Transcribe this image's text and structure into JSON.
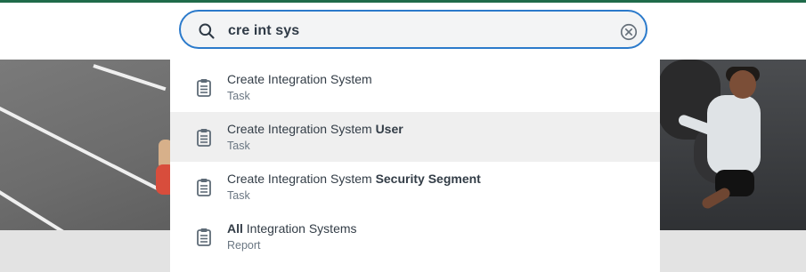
{
  "search": {
    "query": "cre int sys"
  },
  "results": [
    {
      "title_parts": [
        {
          "text": "Create",
          "weight": "normal"
        },
        {
          "text": " ",
          "weight": "normal"
        },
        {
          "text": "Integration",
          "weight": "normal"
        },
        {
          "text": " ",
          "weight": "normal"
        },
        {
          "text": "System",
          "weight": "normal"
        }
      ],
      "type": "Task",
      "highlighted": false
    },
    {
      "title_parts": [
        {
          "text": "Create",
          "weight": "normal"
        },
        {
          "text": " ",
          "weight": "normal"
        },
        {
          "text": "Integration",
          "weight": "normal"
        },
        {
          "text": " ",
          "weight": "normal"
        },
        {
          "text": "System",
          "weight": "normal"
        },
        {
          "text": " ",
          "weight": "normal"
        },
        {
          "text": "User",
          "weight": "bold"
        }
      ],
      "type": "Task",
      "highlighted": true
    },
    {
      "title_parts": [
        {
          "text": "Create",
          "weight": "normal"
        },
        {
          "text": " ",
          "weight": "normal"
        },
        {
          "text": "Integration",
          "weight": "normal"
        },
        {
          "text": " ",
          "weight": "normal"
        },
        {
          "text": "System",
          "weight": "normal"
        },
        {
          "text": " ",
          "weight": "normal"
        },
        {
          "text": "Security Segment",
          "weight": "bold"
        }
      ],
      "type": "Task",
      "highlighted": false
    },
    {
      "title_parts": [
        {
          "text": "All",
          "weight": "bold"
        },
        {
          "text": " ",
          "weight": "normal"
        },
        {
          "text": "Integration",
          "weight": "normal"
        },
        {
          "text": " ",
          "weight": "normal"
        },
        {
          "text": "Systems",
          "weight": "normal"
        }
      ],
      "type": "Report",
      "highlighted": false
    }
  ],
  "icons": {
    "search": "search-icon",
    "clear": "clear-icon",
    "result": "clipboard-icon"
  },
  "colors": {
    "accent": "#2b7acb",
    "top_accent": "#1f6b4a",
    "highlight_row": "#efefef"
  }
}
